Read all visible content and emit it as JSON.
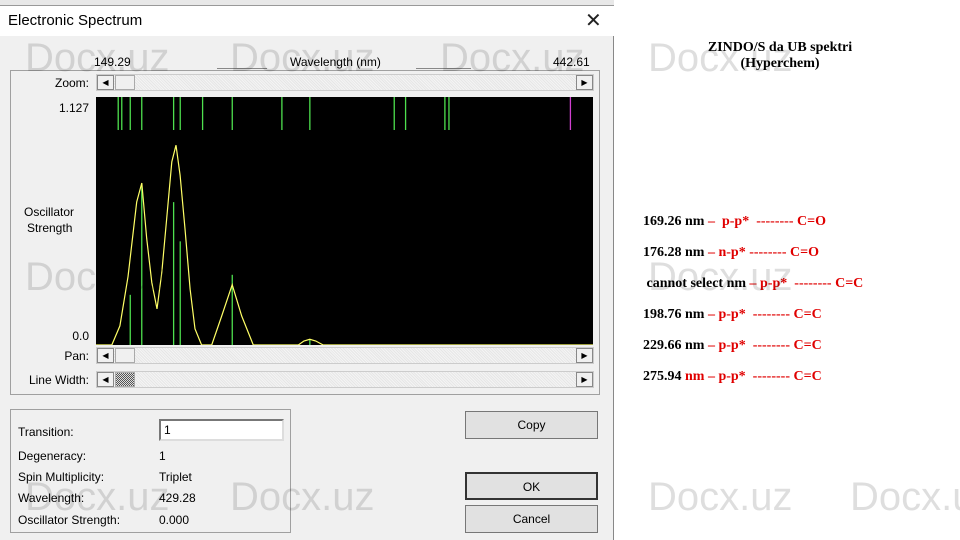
{
  "window": {
    "title": "Electronic Spectrum",
    "close_icon": "close-icon"
  },
  "axis": {
    "min_label": "149.29",
    "title": "Wavelength (nm)",
    "max_label": "442.61",
    "y_max_label": "1.127",
    "y_min_label": "0.0",
    "y_title_1": "Oscillator",
    "y_title_2": "Strength"
  },
  "controls": {
    "zoom": "Zoom:",
    "pan": "Pan:",
    "line_width": "Line Width:"
  },
  "info": {
    "transition_label": "Transition:",
    "transition_value": "1",
    "degeneracy_label": "Degeneracy:",
    "degeneracy_value": "1",
    "spin_label": "Spin Multiplicity:",
    "spin_value": "Triplet",
    "wavelength_label": "Wavelength:",
    "wavelength_value": "429.28",
    "osc_label": "Oscillator Strength:",
    "osc_value": "0.000"
  },
  "buttons": {
    "copy": "Copy",
    "ok": "OK",
    "cancel": "Cancel"
  },
  "notes": {
    "heading_1": "ZINDO/S da UB spektri",
    "heading_2": "(Hyperchem)",
    "lines": [
      {
        "a": "169.26 nm ",
        "b": "–  p-p*  -------- C=O"
      },
      {
        "a": "176.28 nm ",
        "b": "– n-p* -------- C=O"
      },
      {
        "a": " cannot select nm ",
        "b": "– p-p*  -------- C=C"
      },
      {
        "a": "198.76 nm ",
        "b": "– p-p*  -------- C=C"
      },
      {
        "a": "229.66 nm ",
        "b": "– p-p*  -------- C=C"
      },
      {
        "a": "275.94 ",
        "b": "nm – p-p*  -------- C=C"
      }
    ]
  },
  "watermark": "Docx.uz",
  "colors": {
    "stick": "#4ee04e",
    "selected_stick": "#d040d0",
    "curve": "#ffff66",
    "plot_bg": "#000000",
    "notes_accent": "#e00000"
  },
  "chart_data": {
    "type": "line",
    "xlabel": "Wavelength (nm)",
    "ylabel": "Oscillator Strength",
    "xlim": [
      149.29,
      442.61
    ],
    "ylim": [
      0,
      1.127
    ],
    "transitions_nm": [
      162.4,
      164.5,
      169.5,
      176.3,
      195.1,
      199.0,
      212.2,
      229.7,
      259.0,
      275.5,
      325.3,
      332.0,
      355.2,
      357.6,
      429.28
    ],
    "transition_strengths": [
      0,
      0,
      0.228,
      0.733,
      0.649,
      0.471,
      0,
      0.319,
      0,
      0.027,
      0,
      0,
      0,
      0,
      0
    ],
    "selected_transition_nm": 429.28,
    "spectrum": [
      [
        149.29,
        0
      ],
      [
        158.6,
        0
      ],
      [
        163.4,
        0.087
      ],
      [
        168.2,
        0.31
      ],
      [
        173.3,
        0.65
      ],
      [
        176.3,
        0.736
      ],
      [
        179.2,
        0.484
      ],
      [
        182.2,
        0.284
      ],
      [
        185.3,
        0.164
      ],
      [
        188.1,
        0.33
      ],
      [
        191.0,
        0.575
      ],
      [
        194.0,
        0.832
      ],
      [
        196.5,
        0.908
      ],
      [
        198.9,
        0.771
      ],
      [
        201.8,
        0.528
      ],
      [
        204.8,
        0.254
      ],
      [
        207.7,
        0.073
      ],
      [
        211.6,
        0
      ],
      [
        217.6,
        0
      ],
      [
        223.5,
        0.132
      ],
      [
        229.7,
        0.274
      ],
      [
        235.3,
        0.132
      ],
      [
        242.1,
        0
      ],
      [
        268.7,
        0
      ],
      [
        272,
        0.018
      ],
      [
        275.5,
        0.026
      ],
      [
        279,
        0.018
      ],
      [
        283.4,
        0
      ],
      [
        442.61,
        0
      ]
    ]
  }
}
